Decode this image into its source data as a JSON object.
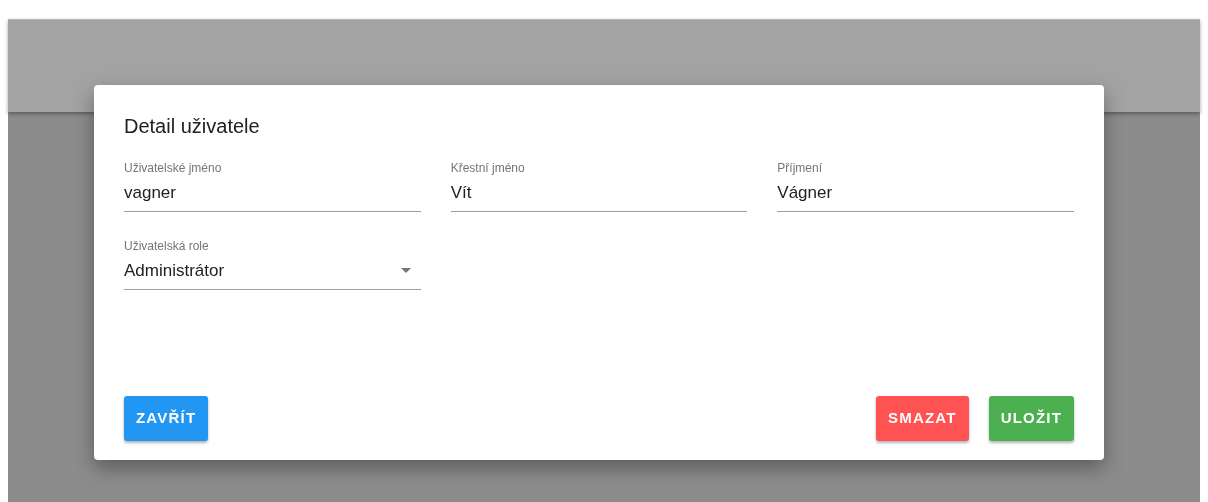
{
  "dialog": {
    "title": "Detail uživatele",
    "fields": [
      {
        "kind": "text",
        "label": "Uživatelské jméno",
        "value": "vagner"
      },
      {
        "kind": "text",
        "label": "Křestní jméno",
        "value": "Vít"
      },
      {
        "kind": "text",
        "label": "Příjmení",
        "value": "Vágner"
      },
      {
        "kind": "select",
        "label": "Uživatelská role",
        "value": "Administrátor"
      }
    ],
    "left_buttons": [
      {
        "label": "ZAVŘÍT",
        "color": "#2196f3"
      }
    ],
    "right_buttons": [
      {
        "label": "SMAZAT",
        "color": "#ff5252"
      },
      {
        "label": "ULOŽIT",
        "color": "#4caf50"
      }
    ]
  }
}
